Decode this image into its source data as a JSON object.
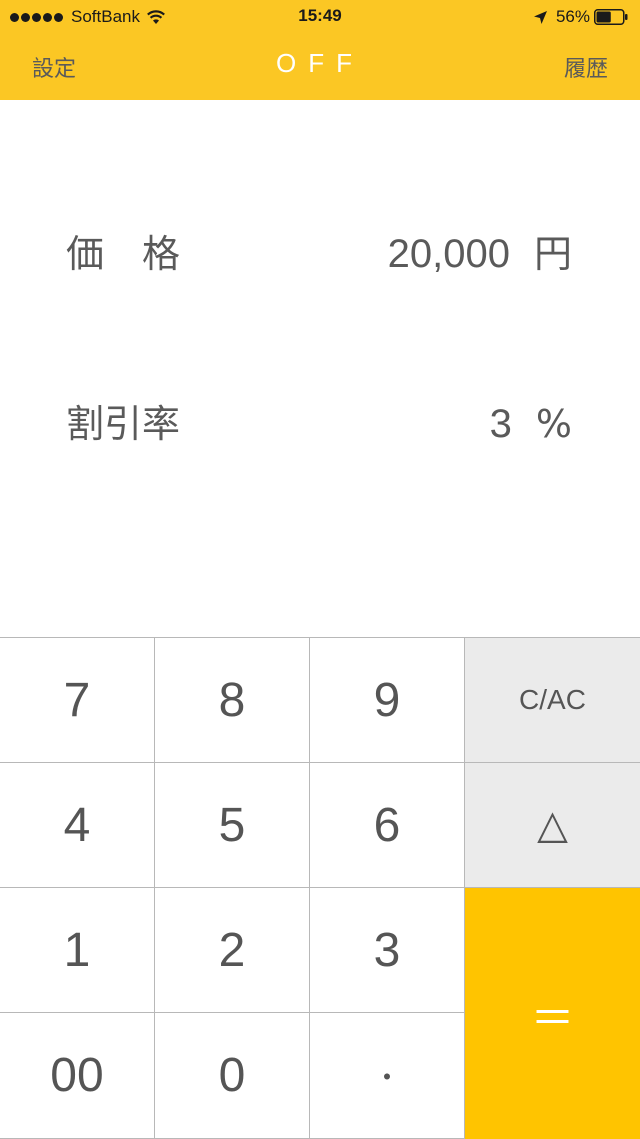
{
  "status_bar": {
    "carrier": "SoftBank",
    "time": "15:49",
    "battery_percent": "56%",
    "battery_level": 0.56,
    "signal_icon": "signal-dots-icon",
    "wifi_icon": "wifi-icon",
    "location_icon": "location-arrow-icon",
    "battery_icon": "battery-icon"
  },
  "nav": {
    "left_label": "設定",
    "title": "OFF",
    "right_label": "履歴"
  },
  "display": {
    "price": {
      "label": "価　格",
      "value": "20,000",
      "unit": "円"
    },
    "rate": {
      "label": "割引率",
      "value": "3",
      "unit": "%"
    }
  },
  "keypad": {
    "k7": "7",
    "k8": "8",
    "k9": "9",
    "clear": "C/AC",
    "k4": "4",
    "k5": "5",
    "k6": "6",
    "triangle": "△",
    "k1": "1",
    "k2": "2",
    "k3": "3",
    "equals": "＝",
    "k00": "00",
    "k0": "0",
    "dot": "・"
  },
  "colors": {
    "header": "#fbc724",
    "equals_key": "#ffc400",
    "function_key": "#ebebeb",
    "text": "#555555"
  }
}
